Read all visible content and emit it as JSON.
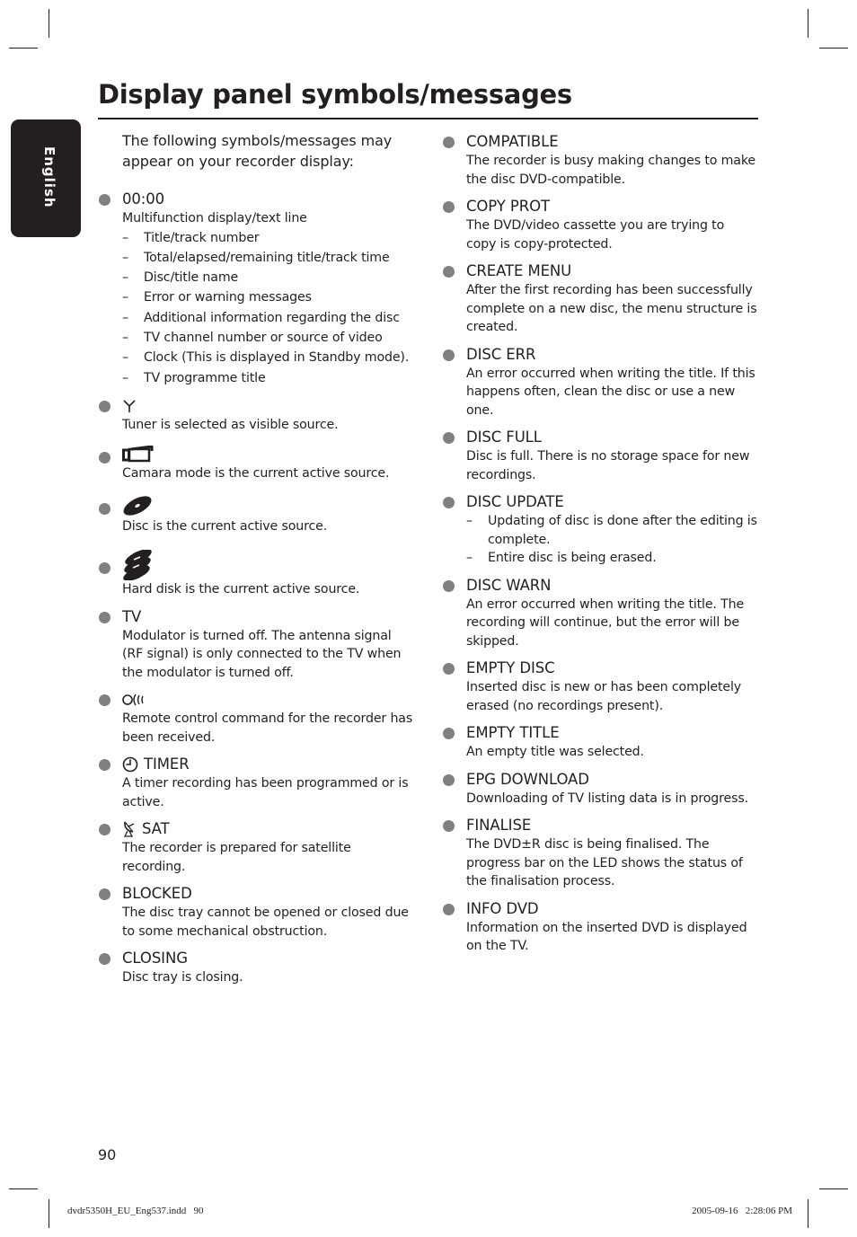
{
  "sidebar_tab": {
    "label": "English"
  },
  "page": {
    "title": "Display panel symbols/messages",
    "intro": "The following symbols/messages may appear on your recorder display:",
    "page_number": "90"
  },
  "left_column": [
    {
      "heading": "00:00",
      "icon": null,
      "description": "Multifunction display/text line",
      "items": [
        "Title/track number",
        "Total/elapsed/remaining title/track time",
        "Disc/title name",
        "Error or warning messages",
        "Additional information regarding the disc",
        "TV channel number or source of video",
        "Clock (This is displayed in Standby mode).",
        "TV programme title"
      ]
    },
    {
      "heading": "",
      "icon": "antenna-icon",
      "description": "Tuner is selected as visible source."
    },
    {
      "heading": "",
      "icon": "camera-icon",
      "description": "Camara mode is the current active source."
    },
    {
      "heading": "",
      "icon": "disc-icon",
      "description": "Disc is the current active source."
    },
    {
      "heading": "",
      "icon": "hard-disk-icon",
      "description": "Hard disk is the current active source."
    },
    {
      "heading": "TV",
      "icon": null,
      "description": "Modulator is turned off. The antenna signal (RF signal) is only connected to the TV when the modulator is turned off."
    },
    {
      "heading": "",
      "icon": "remote-signal-icon",
      "description": "Remote control command for the recorder has been received."
    },
    {
      "heading": "TIMER",
      "icon": "clock-icon",
      "description": "A timer recording has been programmed or is active."
    },
    {
      "heading": "SAT",
      "icon": "satellite-dish-icon",
      "description": "The recorder is prepared for satellite recording."
    },
    {
      "heading": "BLOCKED",
      "icon": null,
      "description": "The disc tray cannot be opened or closed due to some mechanical obstruction."
    },
    {
      "heading": "CLOSING",
      "icon": null,
      "description": "Disc tray is closing."
    }
  ],
  "right_column": [
    {
      "heading": "COMPATIBLE",
      "description": "The recorder is busy making changes to make the disc DVD-compatible."
    },
    {
      "heading": "COPY PROT",
      "description": "The DVD/video cassette you are trying to copy is copy-protected."
    },
    {
      "heading": "CREATE MENU",
      "description": "After the first recording has been successfully complete on a new disc, the menu structure is created."
    },
    {
      "heading": "DISC ERR",
      "description": "An error occurred when writing the title. If this happens often, clean the disc or use a new one."
    },
    {
      "heading": "DISC FULL",
      "description": "Disc is full. There is no storage space for new recordings."
    },
    {
      "heading": "DISC UPDATE",
      "description": null,
      "items": [
        "Updating of disc is done after the editing is complete.",
        "Entire disc is being erased."
      ]
    },
    {
      "heading": "DISC WARN",
      "description": "An error occurred when writing the title. The recording will continue, but the error will be skipped."
    },
    {
      "heading": "EMPTY DISC",
      "description": "Inserted disc is new or has been completely erased (no recordings present)."
    },
    {
      "heading": "EMPTY TITLE",
      "description": "An empty title was selected."
    },
    {
      "heading": "EPG DOWNLOAD",
      "description": "Downloading of TV listing data is in progress."
    },
    {
      "heading": "FINALISE",
      "description": "The DVD±R disc is being finalised. The progress bar on the LED shows the status of the finalisation process."
    },
    {
      "heading": "INFO DVD",
      "description": "Information on the inserted DVD is displayed on the TV."
    }
  ],
  "footer": {
    "file_slug": "dvdr5350H_EU_Eng537.indd   90",
    "timestamp": "2005-09-16   2:28:06 PM"
  },
  "colors": {
    "text": "#231f20",
    "bullet": "#808080",
    "tab_bg": "#231f20"
  }
}
